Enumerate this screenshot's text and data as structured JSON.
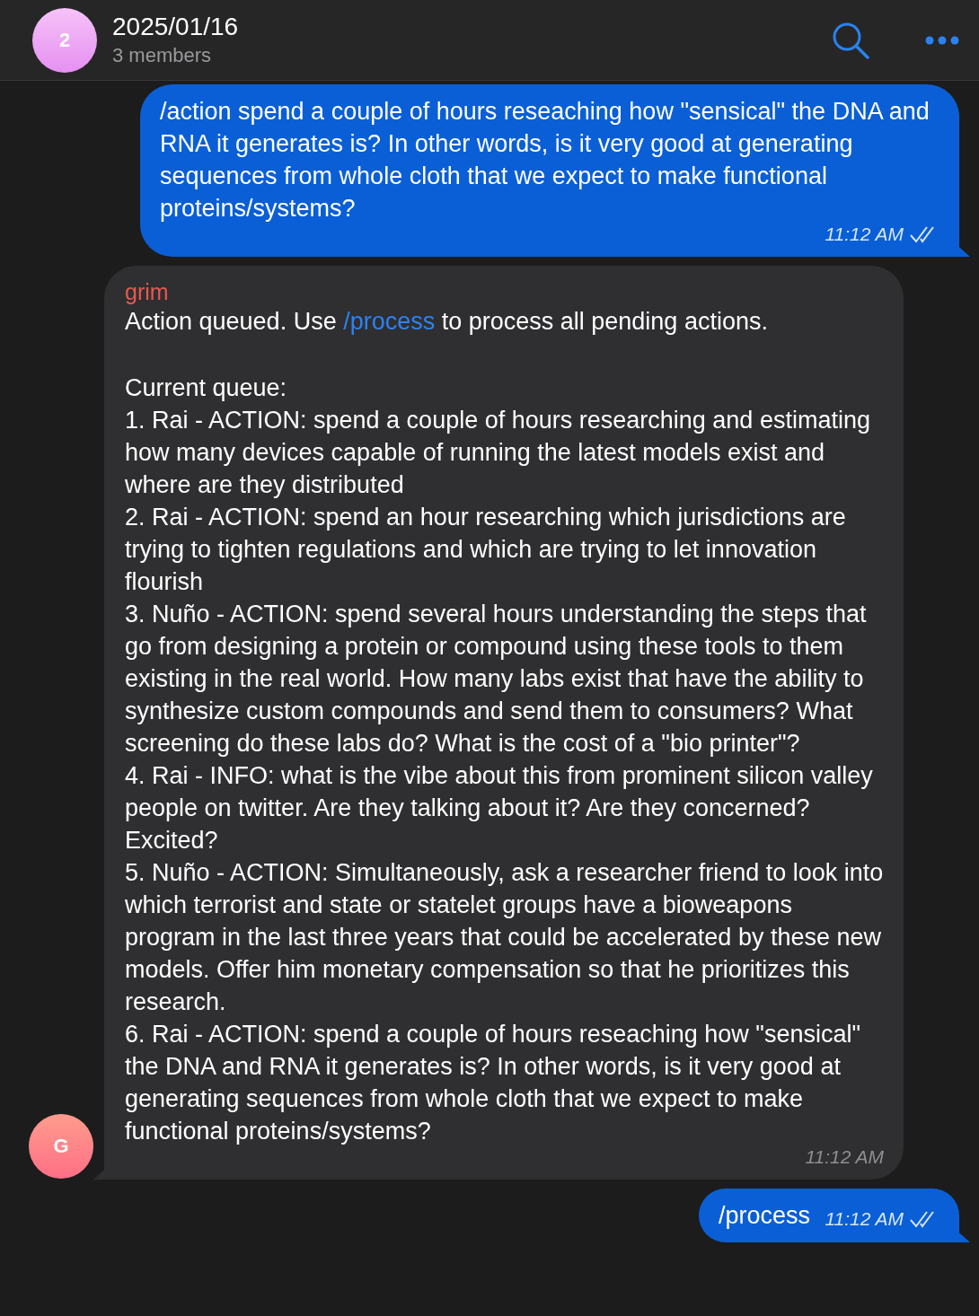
{
  "header": {
    "avatar_letter": "2",
    "title": "2025/01/16",
    "subtitle": "3 members"
  },
  "messages": [
    {
      "kind": "outgoing",
      "text": "/action spend a couple of hours reseaching how \"sensical\" the DNA and RNA it generates is? In other words, is it very good at generating sequences from whole cloth that we expect to make functional proteins/systems?",
      "time": "11:12 AM",
      "read": true
    },
    {
      "kind": "incoming",
      "avatar_letter": "G",
      "sender": "grim",
      "intro_before": "Action queued. Use ",
      "intro_link": "/process",
      "intro_after": " to process all pending actions.",
      "queue_heading": "Current queue:",
      "queue": [
        "1. Rai - ACTION: spend a couple of hours researching and estimating how many devices capable of running the latest models exist and where are they distributed",
        "2. Rai - ACTION: spend an hour researching which jurisdictions are trying to tighten regulations and which are trying to let innovation flourish",
        "3. Nuño - ACTION: spend several hours understanding the steps that go from designing a protein or compound using these tools to them existing in the real world. How many labs exist that have the ability to synthesize custom compounds and send them to consumers? What screening do these labs do? What is the cost of a \"bio printer\"?",
        "4. Rai - INFO: what is the vibe about this from prominent silicon valley people on twitter. Are they talking about it? Are they concerned? Excited?",
        "5. Nuño - ACTION: Simultaneously, ask a researcher friend to look into which terrorist and state or statelet groups have a bioweapons program in the last three years that could be accelerated by these new models. Offer him monetary compensation so that he prioritizes this research.",
        "6. Rai - ACTION: spend a couple of hours reseaching how \"sensical\" the DNA and RNA it generates is? In other words, is it very good at generating sequences from whole cloth that we expect to make functional proteins/systems?"
      ],
      "time": "11:12 AM"
    },
    {
      "kind": "outgoing",
      "text": "/process",
      "time": "11:12 AM",
      "read": true
    }
  ]
}
